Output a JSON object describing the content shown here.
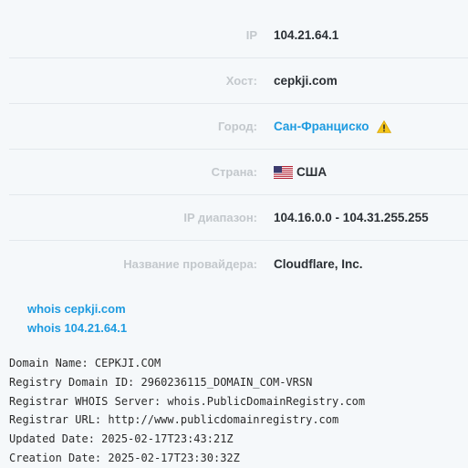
{
  "info": {
    "rows": [
      {
        "label": "IP",
        "value": "104.21.64.1"
      },
      {
        "label": "Хост:",
        "value": "cepkji.com"
      },
      {
        "label": "Город:",
        "value": "Сан-Франциско"
      },
      {
        "label": "Страна:",
        "value": "США"
      },
      {
        "label": "IP диапазон:",
        "value": "104.16.0.0 - 104.31.255.255"
      },
      {
        "label": "Название провайдера:",
        "value": "Cloudflare, Inc."
      }
    ]
  },
  "icons": {
    "warning": "warning-icon",
    "flag": "us-flag-icon"
  },
  "colors": {
    "link": "#1e9be0",
    "label": "#c3c8cc",
    "warning": "#f5c518"
  },
  "links": {
    "whois_domain": "whois cepkji.com",
    "whois_ip": "whois 104.21.64.1"
  },
  "whois": {
    "lines": [
      "Domain Name: CEPKJI.COM",
      "Registry Domain ID: 2960236115_DOMAIN_COM-VRSN",
      "Registrar WHOIS Server: whois.PublicDomainRegistry.com",
      "Registrar URL: http://www.publicdomainregistry.com",
      "Updated Date: 2025-02-17T23:43:21Z",
      "Creation Date: 2025-02-17T23:30:32Z"
    ]
  }
}
